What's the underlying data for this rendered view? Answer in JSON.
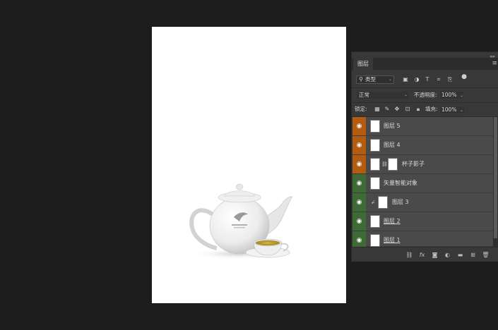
{
  "canvas": {
    "image": "teapot-with-teacup"
  },
  "panel": {
    "tab_label": "图层",
    "filter": {
      "icon": "search-icon",
      "value": "类型"
    },
    "blend_mode": "正常",
    "opacity_label": "不透明度:",
    "opacity_value": "100%",
    "lock_label": "锁定:",
    "fill_label": "填充:",
    "fill_value": "100%",
    "layers": [
      {
        "name": "图层 5",
        "tag_color": "#b35c10"
      },
      {
        "name": "图层 4",
        "tag_color": "#b35c10"
      },
      {
        "name": "杯子影子",
        "tag_color": "#b35c10",
        "has_mask": true
      },
      {
        "name": "矢量智能对象",
        "tag_color": "#3e6a35"
      },
      {
        "name": "图层 3",
        "tag_color": "#3e6a35",
        "clipped": true
      },
      {
        "name": "图层 2",
        "tag_color": "#3e6a35"
      },
      {
        "name": "图层 1",
        "tag_color": "#3e6a35"
      }
    ]
  }
}
